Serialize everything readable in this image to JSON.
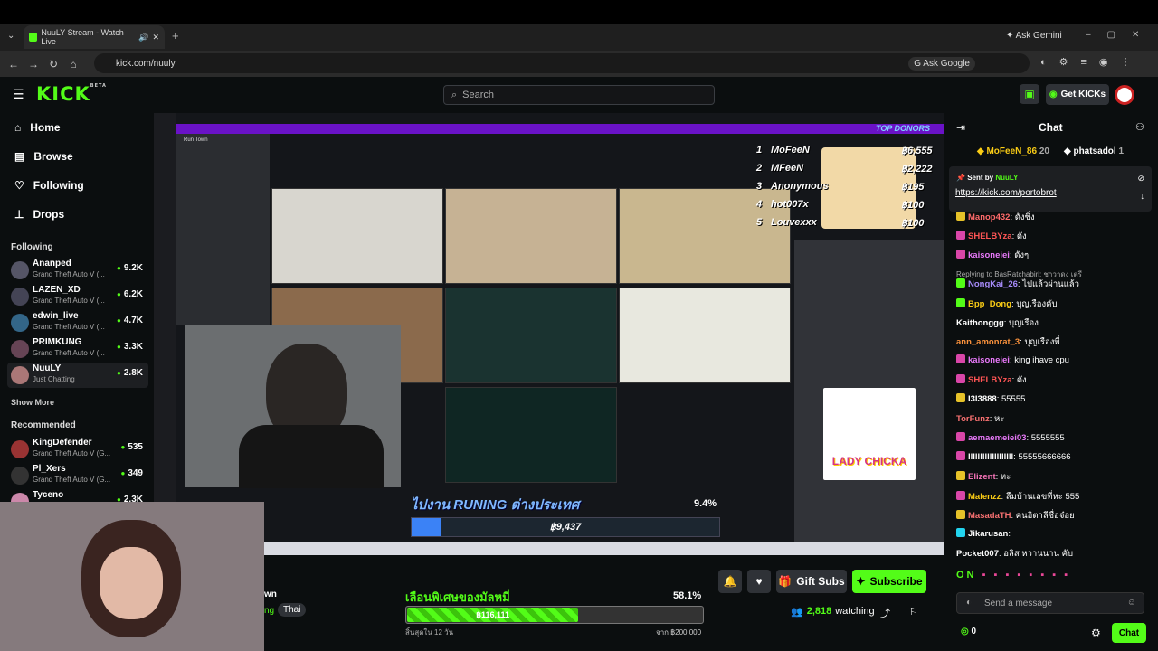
{
  "browser": {
    "tab_title": "NuuLY Stream - Watch Live",
    "ask_gemini": "Ask Gemini",
    "url": "kick.com/nuuly",
    "ask_google": "Ask Google"
  },
  "header": {
    "logo": "KICK",
    "logo_badge": "BETA",
    "search_placeholder": "Search",
    "get_kicks": "Get KICKs"
  },
  "sidebar": {
    "nav": [
      {
        "label": "Home",
        "icon": "home-icon"
      },
      {
        "label": "Browse",
        "icon": "browse-icon"
      },
      {
        "label": "Following",
        "icon": "heart-icon"
      },
      {
        "label": "Drops",
        "icon": "drops-icon"
      }
    ],
    "following_title": "Following",
    "following": [
      {
        "name": "Ananped",
        "game": "Grand Theft Auto V (...",
        "viewers": "9.2K"
      },
      {
        "name": "LAZEN_XD",
        "game": "Grand Theft Auto V (...",
        "viewers": "6.2K"
      },
      {
        "name": "edwin_live",
        "game": "Grand Theft Auto V (...",
        "viewers": "4.7K"
      },
      {
        "name": "PRIMKUNG",
        "game": "Grand Theft Auto V (...",
        "viewers": "3.3K"
      },
      {
        "name": "NuuLY",
        "game": "Just Chatting",
        "viewers": "2.8K"
      }
    ],
    "show_more": "Show More",
    "recommended_title": "Recommended",
    "recommended": [
      {
        "name": "KingDefender",
        "game": "Grand Theft Auto V (G...",
        "viewers": "535"
      },
      {
        "name": "Pl_Xers",
        "game": "Grand Theft Auto V (G...",
        "viewers": "349"
      },
      {
        "name": "Tyceno",
        "game": "",
        "viewers": "2.3K"
      }
    ]
  },
  "stream": {
    "overlay_top_donors": "TOP DONORS",
    "donors": [
      {
        "rank": "1",
        "name": "MoFeeN",
        "amount": "฿6,555"
      },
      {
        "rank": "2",
        "name": "MFeeN",
        "amount": "฿2,222"
      },
      {
        "rank": "3",
        "name": "Anonymous",
        "amount": "฿195"
      },
      {
        "rank": "4",
        "name": "hot007x",
        "amount": "฿100"
      },
      {
        "rank": "5",
        "name": "Louvexxx",
        "amount": "฿100"
      }
    ],
    "run_title": "ไปงาน RUNING ต่างประเทศ",
    "run_pct": "9.4%",
    "run_amount": "฿9,437",
    "run_progress": 0.094,
    "discord_left_title": "Run Town",
    "lady_chicka": "LADY CHICKA"
  },
  "below": {
    "streamer_frag": "wn",
    "category_frag": "ng",
    "tag": "Thai",
    "goal_title": "เลือนพิเศษของมัลหมี่",
    "goal_pct": "58.1%",
    "goal_progress": 0.581,
    "goal_current": "฿116,111",
    "goal_left": "สิ้นสุดใน 12 วัน",
    "goal_target": "จาก ฿200,000",
    "gift_subs": "Gift Subs",
    "subscribe": "Subscribe",
    "watching": "2,818",
    "watching_label": "watching"
  },
  "chat": {
    "title": "Chat",
    "top_gifters": [
      {
        "name": "MoFeeN_86",
        "count": "20"
      },
      {
        "name": "phatsadol",
        "count": "1"
      }
    ],
    "pinned_sent_by": "Sent by",
    "pinned_user": "NuuLY",
    "pinned_link": "https://kick.com/portobrot",
    "messages": [
      {
        "user": "Manop432",
        "color": "#ff6b6b",
        "text": "ดังชิ่ง",
        "badge": "#e6c229"
      },
      {
        "user": "SHELBYza",
        "color": "#ff5555",
        "text": "ดัง",
        "badge": "#d946a8"
      },
      {
        "user": "kaisoneiei",
        "color": "#e879f9",
        "text": "ดังๆ",
        "badge": "#d946a8"
      },
      {
        "user": "",
        "color": "#aaa",
        "text": "Replying to BasRatchabiri: ชาวาดง เตรี",
        "badge": ""
      },
      {
        "user": "NongKai_26",
        "color": "#a78bfa",
        "text": "ไปแล้วผ่านแล้ว",
        "badge": "#53fc18"
      },
      {
        "user": "Bpp_Dong",
        "color": "#facc15",
        "text": "บุญเรืองคับ",
        "badge": "#53fc18"
      },
      {
        "user": "Kaithonggg",
        "color": "#fff",
        "text": "บุญเรือง",
        "badge": ""
      },
      {
        "user": "ann_amonrat_3",
        "color": "#fb923c",
        "text": "บุญเรืองพี่",
        "badge": ""
      },
      {
        "user": "kaisoneiei",
        "color": "#e879f9",
        "text": "king ihave cpu",
        "badge": "#d946a8"
      },
      {
        "user": "SHELBYza",
        "color": "#ff5555",
        "text": "ดัง",
        "badge": "#d946a8"
      },
      {
        "user": "I3I3888",
        "color": "#fff",
        "text": "55555",
        "badge": "#e6c229"
      },
      {
        "user": "TorFunz",
        "color": "#f87171",
        "text": "หะ",
        "badge": ""
      },
      {
        "user": "aemaemeiei03",
        "color": "#e879f9",
        "text": "5555555",
        "badge": "#d946a8"
      },
      {
        "user": "lllllllllllllllllll",
        "color": "#fff",
        "text": "55555666666",
        "badge": "#d946a8"
      },
      {
        "user": "Elizent",
        "color": "#f472b6",
        "text": "หะ",
        "badge": "#e6c229"
      },
      {
        "user": "Malenzz",
        "color": "#facc15",
        "text": "ลืมบ้านเลขที่หะ 555",
        "badge": "#d946a8"
      },
      {
        "user": "MasadaTH",
        "color": "#f87171",
        "text": "คนอิตาลีชื่อจ๋อย",
        "badge": "#e6c229"
      },
      {
        "user": "Jikarusan",
        "color": "#fff",
        "text": "",
        "badge": "#22d3ee"
      },
      {
        "user": "Pocket007",
        "color": "#fff",
        "text": "อลิส หวานนาน คับ",
        "badge": ""
      }
    ],
    "emote_row": "ON",
    "send_placeholder": "Send a message",
    "points": "0",
    "chat_button": "Chat"
  }
}
